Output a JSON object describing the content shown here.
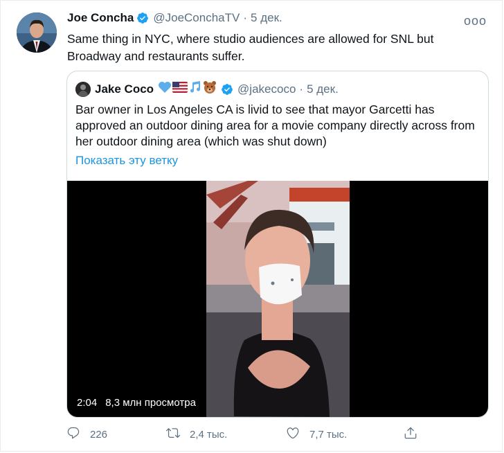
{
  "author": {
    "name": "Joe Concha",
    "handle": "@JoeConchaTV",
    "separator": "·",
    "date": "5 дек.",
    "more": "ooo"
  },
  "tweet": {
    "text": "Same thing in NYC, where studio audiences are allowed for SNL but Broadway and restaurants suffer."
  },
  "quoted": {
    "name": "Jake Coco",
    "handle": "@jakecoco",
    "separator": "·",
    "date": "5 дек.",
    "text": "Bar owner in Los Angeles CA is livid to see that mayor Garcetti has approved an outdoor dining area for a movie company directly across from her outdoor dining area (which was shut down)",
    "show_thread": "Показать эту ветку",
    "video": {
      "duration": "2:04",
      "views": "8,3 млн просмотра"
    }
  },
  "actions": {
    "replies": "226",
    "retweets": "2,4 тыс.",
    "likes": "7,7 тыс."
  },
  "colors": {
    "accent": "#1da1f2",
    "link": "#1b95e0",
    "secondary_text": "#5b7083"
  },
  "icons": [
    "verified-badge-icon",
    "more-icon",
    "blue-heart-icon",
    "us-flag-icon",
    "music-notes-icon",
    "bear-face-icon",
    "reply-icon",
    "retweet-icon",
    "like-icon",
    "share-icon"
  ]
}
